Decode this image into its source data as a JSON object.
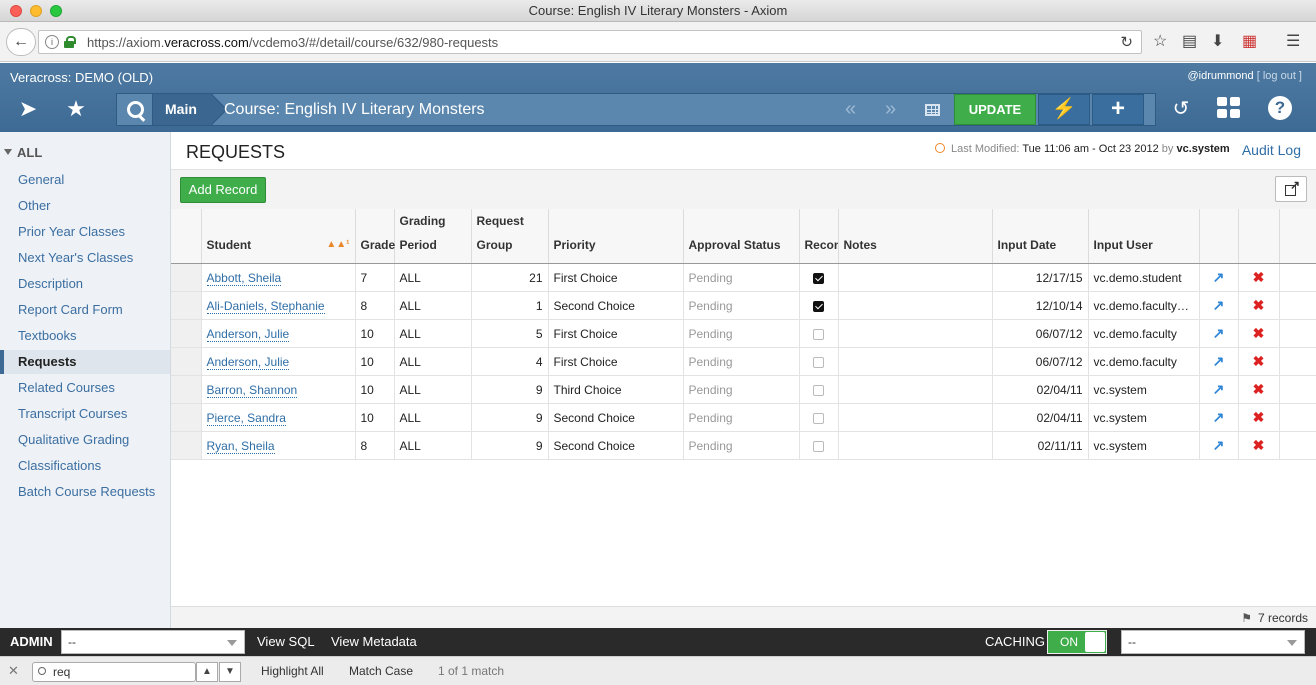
{
  "window": {
    "title": "Course: English IV Literary Monsters - Axiom"
  },
  "browser": {
    "url_prefix": "https://axiom.",
    "url_domain": "veracross.com",
    "url_path": "/vcdemo3/#/detail/course/632/980-requests"
  },
  "app": {
    "name": "Veracross: DEMO (OLD)",
    "user": "@idrummond",
    "logout": "[ log out ]",
    "breadcrumb_main": "Main",
    "breadcrumb_title": "Course: English IV Literary Monsters",
    "update_label": "UPDATE"
  },
  "sidebar": {
    "all_label": "ALL",
    "items": [
      "General",
      "Other",
      "Prior Year Classes",
      "Next Year's Classes",
      "Description",
      "Report Card Form",
      "Textbooks",
      "Requests",
      "Related Courses",
      "Transcript Courses",
      "Qualitative Grading",
      "Classifications",
      "Batch Course Requests"
    ],
    "active": "Requests"
  },
  "main": {
    "title": "REQUESTS",
    "last_modified_label": "Last Modified:",
    "last_modified_value": "Tue 11:06 am - Oct 23 2012",
    "by_label": "by",
    "by_user": "vc.system",
    "audit_log": "Audit Log",
    "add_record": "Add Record",
    "footer_count": "7 records"
  },
  "table": {
    "headers": {
      "student": "Student",
      "grade": "Grade",
      "grading_period_1": "Grading",
      "grading_period_2": "Period",
      "request_group_1": "Request",
      "request_group_2": "Group",
      "priority": "Priority",
      "approval_status": "Approval Status",
      "recon": "Recon",
      "notes": "Notes",
      "input_date": "Input Date",
      "input_user": "Input User"
    },
    "rows": [
      {
        "student": "Abbott, Sheila",
        "grade": "7",
        "period": "ALL",
        "group": "21",
        "priority": "First Choice",
        "status": "Pending",
        "recon": true,
        "notes": "",
        "date": "12/17/15",
        "user": "vc.demo.student"
      },
      {
        "student": "Ali-Daniels, Stephanie",
        "grade": "8",
        "period": "ALL",
        "group": "1",
        "priority": "Second Choice",
        "status": "Pending",
        "recon": true,
        "notes": "",
        "date": "12/10/14",
        "user": "vc.demo.faculty_..."
      },
      {
        "student": "Anderson, Julie",
        "grade": "10",
        "period": "ALL",
        "group": "5",
        "priority": "First Choice",
        "status": "Pending",
        "recon": false,
        "notes": "",
        "date": "06/07/12",
        "user": "vc.demo.faculty"
      },
      {
        "student": "Anderson, Julie",
        "grade": "10",
        "period": "ALL",
        "group": "4",
        "priority": "First Choice",
        "status": "Pending",
        "recon": false,
        "notes": "",
        "date": "06/07/12",
        "user": "vc.demo.faculty"
      },
      {
        "student": "Barron, Shannon",
        "grade": "10",
        "period": "ALL",
        "group": "9",
        "priority": "Third Choice",
        "status": "Pending",
        "recon": false,
        "notes": "",
        "date": "02/04/11",
        "user": "vc.system"
      },
      {
        "student": "Pierce, Sandra",
        "grade": "10",
        "period": "ALL",
        "group": "9",
        "priority": "Second Choice",
        "status": "Pending",
        "recon": false,
        "notes": "",
        "date": "02/04/11",
        "user": "vc.system"
      },
      {
        "student": "Ryan, Sheila",
        "grade": "8",
        "period": "ALL",
        "group": "9",
        "priority": "Second Choice",
        "status": "Pending",
        "recon": false,
        "notes": "",
        "date": "02/11/11",
        "user": "vc.system"
      }
    ]
  },
  "admin": {
    "label": "ADMIN",
    "select1_value": "--",
    "view_sql": "View SQL",
    "view_metadata": "View Metadata",
    "caching_label": "CACHING",
    "caching_state": "ON",
    "select2_value": "--"
  },
  "findbar": {
    "query": "req",
    "highlight_all": "Highlight All",
    "match_case": "Match Case",
    "result": "1 of 1 match"
  },
  "colors": {
    "header_blue": "#3d6a94",
    "green": "#3fae4a",
    "link_blue": "#2f6ea6",
    "delete_red": "#dd2222"
  }
}
